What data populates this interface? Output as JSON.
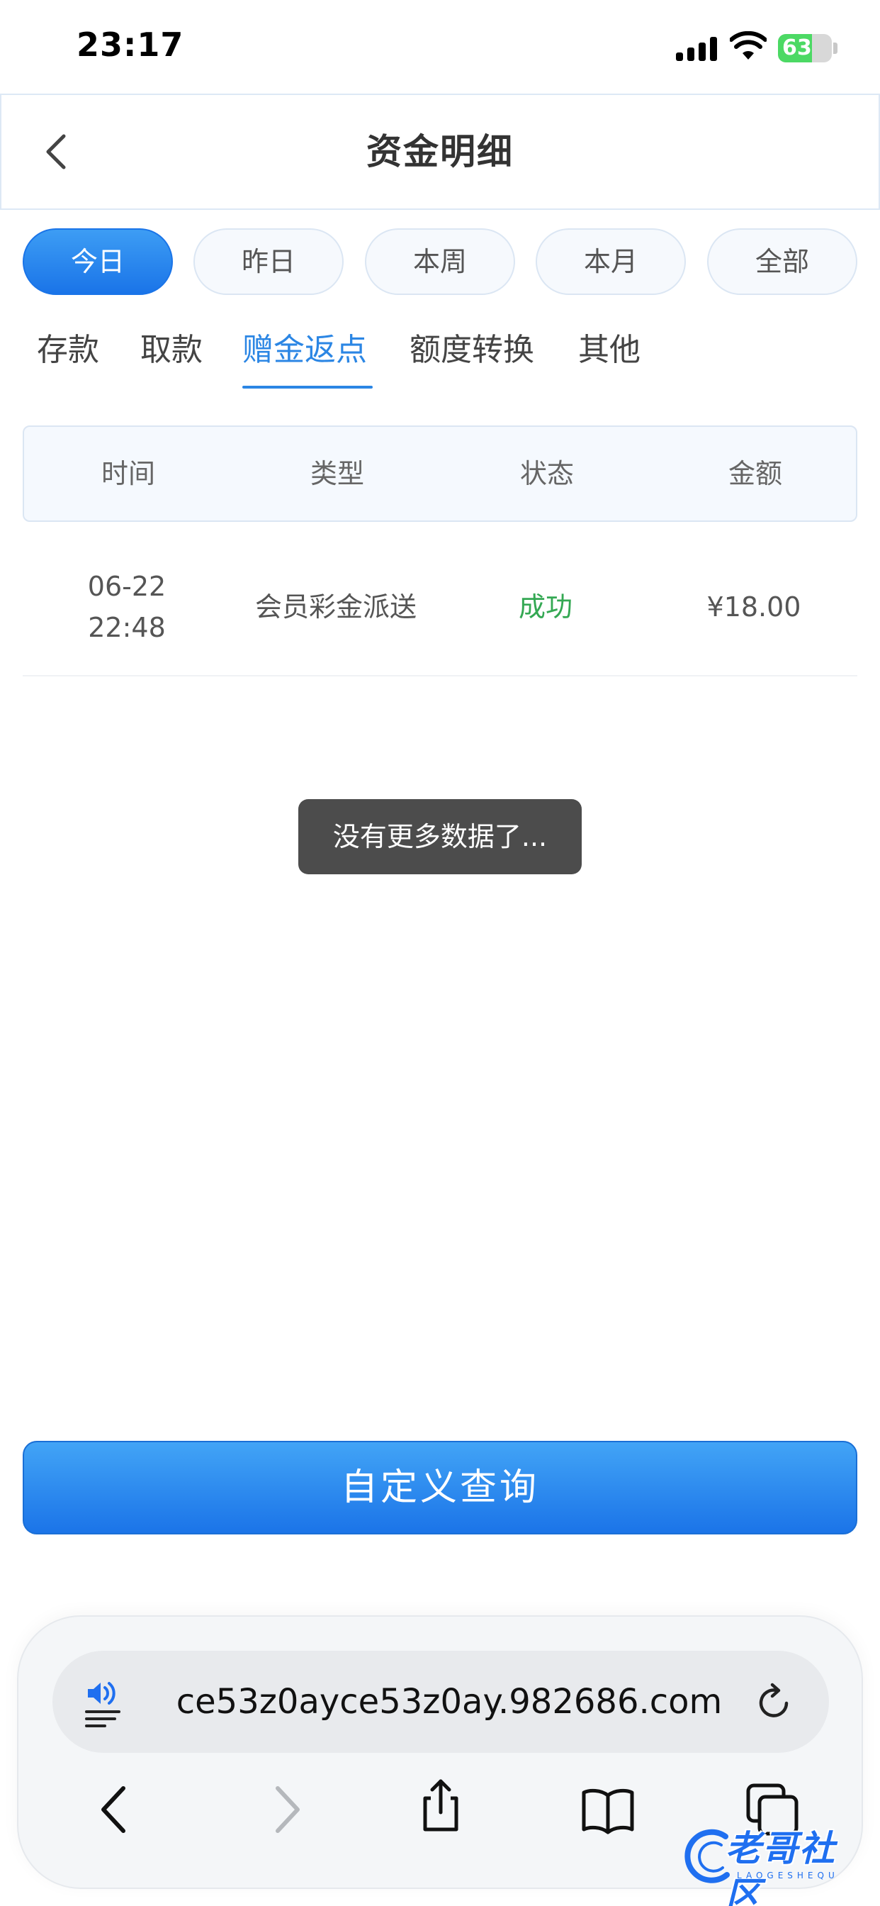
{
  "status_bar": {
    "time": "23:17",
    "battery_level": "63",
    "battery_color": "#4cd964"
  },
  "header": {
    "title": "资金明细",
    "back_icon": "chevron-left-icon"
  },
  "period_filters": [
    {
      "label": "今日",
      "active": true
    },
    {
      "label": "昨日",
      "active": false
    },
    {
      "label": "本周",
      "active": false
    },
    {
      "label": "本月",
      "active": false
    },
    {
      "label": "全部",
      "active": false
    }
  ],
  "category_tabs": [
    {
      "label": "存款",
      "active": false
    },
    {
      "label": "取款",
      "active": false
    },
    {
      "label": "赠金返点",
      "active": true
    },
    {
      "label": "额度转换",
      "active": false
    },
    {
      "label": "其他",
      "active": false
    }
  ],
  "table": {
    "headers": [
      "时间",
      "类型",
      "状态",
      "金额"
    ],
    "rows": [
      {
        "date": "06-22",
        "time": "22:48",
        "type": "会员彩金派送",
        "status": "成功",
        "amount": "¥18.00"
      }
    ]
  },
  "toast": "没有更多数据了...",
  "query_button": "自定义查询",
  "browser": {
    "url": "ce53z0ayce53z0ay.982686.com"
  },
  "watermark": {
    "text": "老哥社区",
    "sub": "LAOGESHEQU"
  },
  "colors": {
    "accent": "#2b86e4",
    "success": "#34a853"
  }
}
